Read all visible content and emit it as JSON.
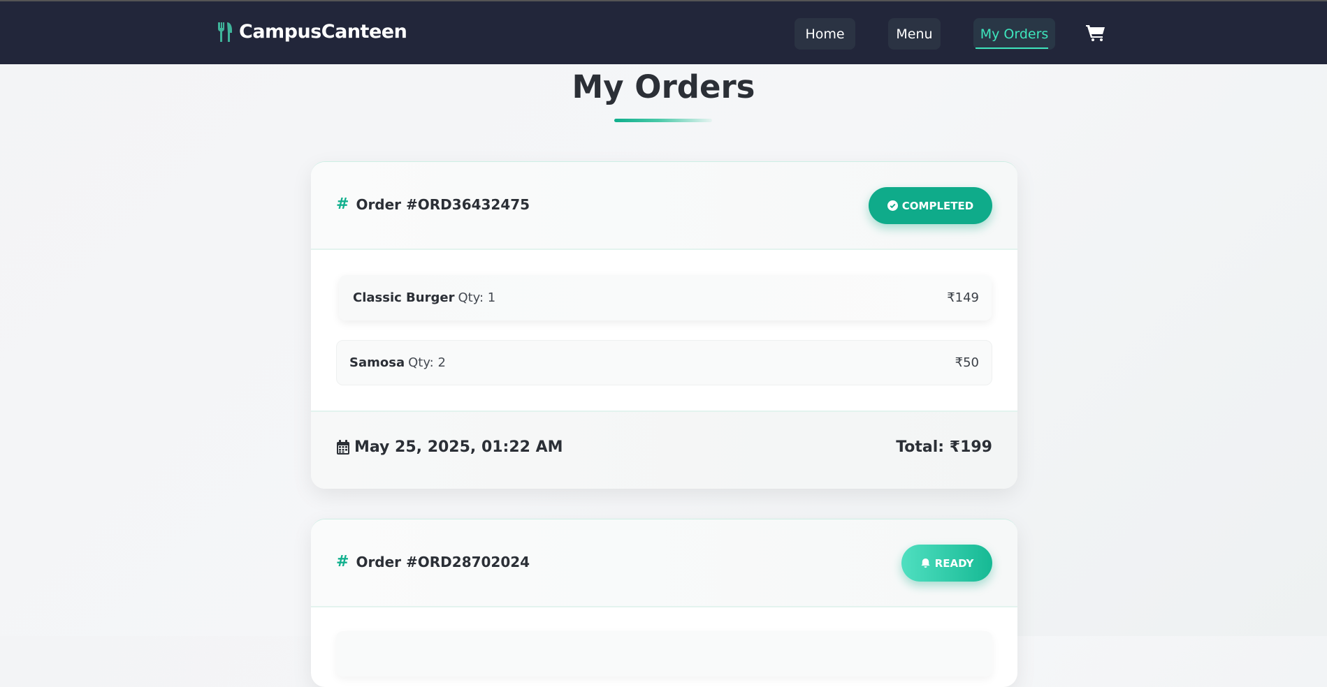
{
  "brand": {
    "name": "CampusCanteen",
    "icon": "utensils-icon"
  },
  "nav": {
    "links": [
      {
        "label": "Home",
        "active": false
      },
      {
        "label": "Menu",
        "active": false
      },
      {
        "label": "My Orders",
        "active": true
      }
    ],
    "cart_icon": "shopping-cart-icon"
  },
  "page": {
    "title": "My Orders"
  },
  "orders": [
    {
      "id_label": "Order #ORD36432475",
      "status": "COMPLETED",
      "status_icon": "check-circle-icon",
      "items": [
        {
          "name": "Classic Burger",
          "qty": "Qty: 1",
          "price": "₹149"
        },
        {
          "name": "Samosa",
          "qty": "Qty: 2",
          "price": "₹50"
        }
      ],
      "date": "May 25, 2025, 01:22 AM",
      "total": "Total: ₹199"
    },
    {
      "id_label": "Order #ORD28702024",
      "status": "READY",
      "status_icon": "bell-icon"
    }
  ],
  "colors": {
    "navbar_bg": "#22263a",
    "accent": "#0fab8a",
    "accent_light": "#3ee6bd",
    "text_dark": "#2b2f36"
  }
}
